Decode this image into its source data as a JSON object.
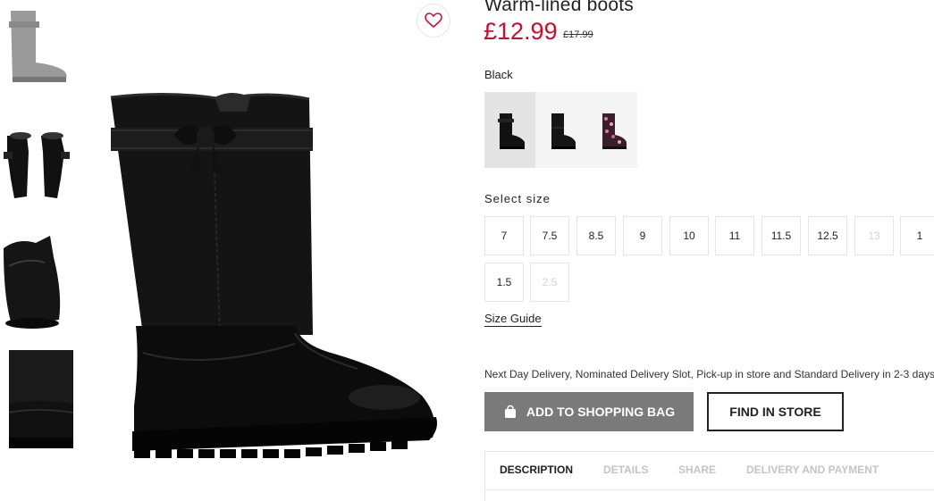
{
  "product": {
    "title": "Warm-lined boots",
    "price": "£12.99",
    "old_price": "£17.99"
  },
  "favorite": {
    "icon": "heart-icon"
  },
  "color": {
    "selected_label": "Black",
    "swatches": [
      {
        "name": "black-boot-a",
        "selected": true
      },
      {
        "name": "black-boot-b",
        "selected": false
      },
      {
        "name": "floral-boot",
        "selected": false
      }
    ]
  },
  "size": {
    "label": "Select size",
    "options": [
      {
        "label": "7",
        "available": true
      },
      {
        "label": "7.5",
        "available": true
      },
      {
        "label": "8.5",
        "available": true
      },
      {
        "label": "9",
        "available": true
      },
      {
        "label": "10",
        "available": true
      },
      {
        "label": "11",
        "available": true
      },
      {
        "label": "11.5",
        "available": true
      },
      {
        "label": "12.5",
        "available": true
      },
      {
        "label": "13",
        "available": false
      },
      {
        "label": "1",
        "available": true
      },
      {
        "label": "1.5",
        "available": true
      },
      {
        "label": "2.5",
        "available": false
      }
    ],
    "guide_label": "Size Guide"
  },
  "delivery_text": "Next Day Delivery, Nominated Delivery Slot, Pick-up in store and Standard Delivery in 2-3 days.",
  "actions": {
    "add_to_bag": "ADD TO SHOPPING BAG",
    "add_to_bag_icon": "shopping-bag-icon",
    "find_in_store": "FIND IN STORE"
  },
  "tabs": [
    {
      "label": "DESCRIPTION",
      "active": true
    },
    {
      "label": "DETAILS",
      "active": false
    },
    {
      "label": "SHARE",
      "active": false
    },
    {
      "label": "DELIVERY AND PAYMENT",
      "active": false
    }
  ],
  "colors": {
    "price_red": "#c8102e",
    "bag_button_grey": "#7a7a7a",
    "disabled_size": "#d4d4d4",
    "inactive_tab": "#c4c4c4"
  }
}
